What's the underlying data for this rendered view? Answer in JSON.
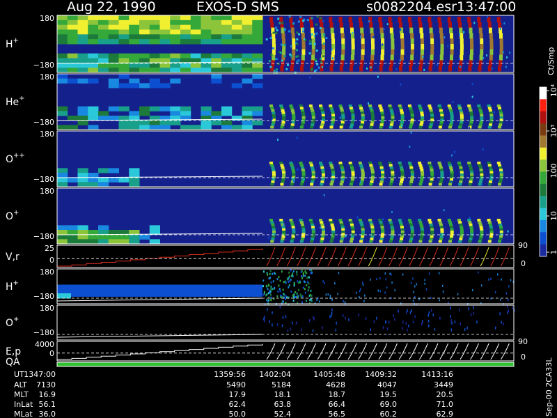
{
  "header": {
    "date": "Aug 22, 1990",
    "instrument": "EXOS-D SMS",
    "file": "s0082204.esr",
    "time": "13:47:00"
  },
  "colorbar": {
    "unit_label": "Ct/Smp",
    "scale": "log",
    "ticks": [
      "1",
      "10",
      "100",
      "10³",
      "10⁴"
    ],
    "colors": [
      "#1a2aa0",
      "#0c4fd0",
      "#1888e0",
      "#2ac8d8",
      "#19a08a",
      "#1c7a3a",
      "#35a83a",
      "#8cc43a",
      "#f0f030",
      "#a07830",
      "#7a3a12",
      "#b01010",
      "#ff2010",
      "#ffffff"
    ]
  },
  "panels": [
    {
      "id": "h_plus",
      "label": "H",
      "sup": "+",
      "ymax": "180",
      "ymin": "−180"
    },
    {
      "id": "he_plus",
      "label": "He",
      "sup": "+",
      "ymax": "180",
      "ymin": "−180"
    },
    {
      "id": "o_pp",
      "label": "O",
      "sup": "++",
      "ymax": "180",
      "ymin": "−180"
    },
    {
      "id": "o_plus",
      "label": "O",
      "sup": "+",
      "ymax": "180",
      "ymin": "−180"
    },
    {
      "id": "vr",
      "label": "V,r",
      "sup": "",
      "ymax": "25",
      "ymin": "0",
      "rmax": "90",
      "rmin": "0"
    },
    {
      "id": "h_plus_2",
      "label": "H",
      "sup": "+",
      "ymax": "180",
      "ymin": "−180"
    },
    {
      "id": "o_plus_2",
      "label": "O",
      "sup": "+",
      "ymax": "180",
      "ymin": "−180"
    },
    {
      "id": "ep",
      "label": "E,p",
      "sup": "",
      "ymax": "4000",
      "ymin": "0",
      "rmax": "90",
      "rmin": "0"
    },
    {
      "id": "qa",
      "label": "QA",
      "sup": "",
      "ymax": "",
      "ymin": ""
    }
  ],
  "ephemeris": {
    "row_labels": [
      "UT",
      "ALT",
      "MLT",
      "InLat",
      "MLat"
    ],
    "columns": [
      {
        "UT": "1347:00",
        "ALT": "7130",
        "MLT": "16.9",
        "InLat": "56.1",
        "MLat": "36.0"
      },
      {
        "UT": "1359:56",
        "ALT": "5490",
        "MLT": "17.9",
        "InLat": "62.4",
        "MLat": "50.0"
      },
      {
        "UT": "1402:04",
        "ALT": "5184",
        "MLT": "18.1",
        "InLat": "63.8",
        "MLat": "52.4"
      },
      {
        "UT": "1405:48",
        "ALT": "4628",
        "MLT": "18.7",
        "InLat": "66.4",
        "MLat": "56.5"
      },
      {
        "UT": "1409:32",
        "ALT": "4047",
        "MLT": "19.5",
        "InLat": "69.0",
        "MLat": "60.2"
      },
      {
        "UT": "1413:16",
        "ALT": "3449",
        "MLT": "20.5",
        "InLat": "71.0",
        "MLat": "62.9"
      }
    ]
  },
  "footer_tag": "Sep-00 2CA33L",
  "chart_data": {
    "type": "heatmap",
    "title": "Aug 22, 1990 EXOS-D SMS",
    "x_label": "UT",
    "x_ticks": [
      "1347:00",
      "1359:56",
      "1402:04",
      "1405:48",
      "1409:32",
      "1413:16"
    ],
    "panels": [
      {
        "species": "H+",
        "y_range": [
          -180,
          180
        ],
        "y_unit": "deg"
      },
      {
        "species": "He+",
        "y_range": [
          -180,
          180
        ],
        "y_unit": "deg"
      },
      {
        "species": "O++",
        "y_range": [
          -180,
          180
        ],
        "y_unit": "deg"
      },
      {
        "species": "O+",
        "y_range": [
          -180,
          180
        ],
        "y_unit": "deg"
      },
      {
        "species": "V,r",
        "y_range": [
          0,
          25
        ],
        "right_range": [
          0,
          90
        ]
      },
      {
        "species": "H+",
        "y_range": [
          -180,
          180
        ],
        "y_unit": "deg"
      },
      {
        "species": "O+",
        "y_range": [
          -180,
          180
        ],
        "y_unit": "deg"
      },
      {
        "species": "E,p",
        "y_range": [
          0,
          4000
        ],
        "right_range": [
          0,
          90
        ]
      },
      {
        "species": "QA"
      }
    ],
    "color_scale": {
      "unit": "Ct/Smp",
      "type": "log",
      "min": 1,
      "max": 10000
    }
  }
}
